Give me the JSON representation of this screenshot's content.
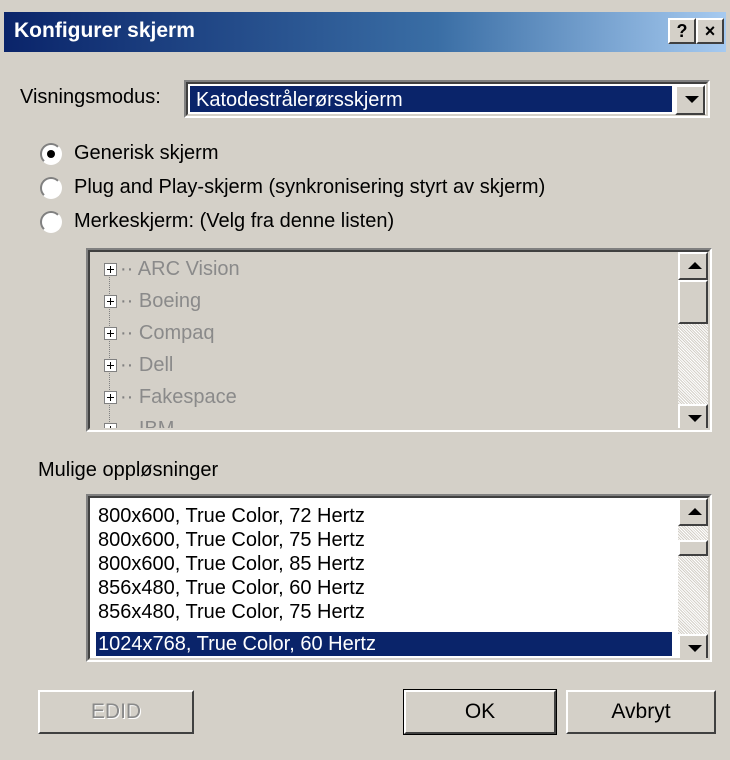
{
  "window": {
    "title": "Konfigurer skjerm",
    "help_label": "?",
    "close_label": "×"
  },
  "mode": {
    "label": "Visningsmodus:",
    "value": "Katodestrålerørsskjerm"
  },
  "radios": [
    {
      "label": "Generisk skjerm",
      "checked": true
    },
    {
      "label": "Plug and Play-skjerm (synkronisering styrt av skjerm)",
      "checked": false
    },
    {
      "label": "Merkeskjerm: (Velg fra denne listen)",
      "checked": false
    }
  ],
  "manufacturers": [
    "ARC Vision",
    "Boeing",
    "Compaq",
    "Dell",
    "Fakespace",
    "IBM"
  ],
  "resolutions": {
    "label": "Mulige oppløsninger",
    "items": [
      "800x600, True Color, 72 Hertz",
      "800x600, True Color, 75 Hertz",
      "800x600, True Color, 85 Hertz",
      "856x480, True Color, 60 Hertz",
      "856x480, True Color, 75 Hertz",
      "1024x768, True Color, 60 Hertz"
    ],
    "selected": "1024x768, True Color, 60 Hertz"
  },
  "buttons": {
    "edid": "EDID",
    "ok": "OK",
    "cancel": "Avbryt"
  },
  "colors": {
    "title_start": "#0a246a",
    "title_end": "#a6caf0",
    "face": "#d4d0c8",
    "selection": "#0a246a",
    "disabled_text": "#8a8a8a"
  }
}
